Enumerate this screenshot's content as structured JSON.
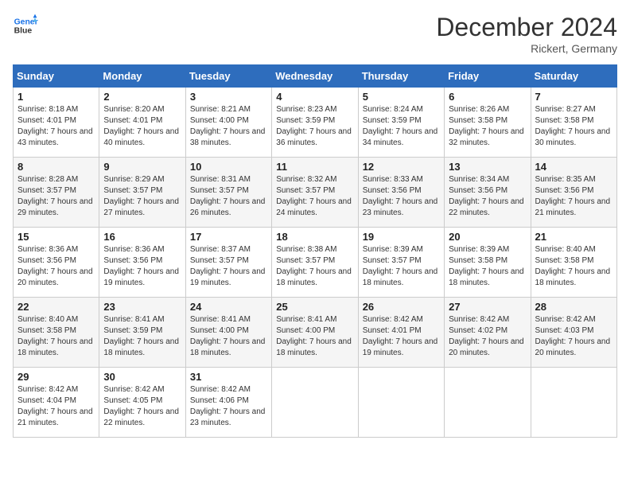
{
  "header": {
    "logo_line1": "General",
    "logo_line2": "Blue",
    "month": "December 2024",
    "location": "Rickert, Germany"
  },
  "weekdays": [
    "Sunday",
    "Monday",
    "Tuesday",
    "Wednesday",
    "Thursday",
    "Friday",
    "Saturday"
  ],
  "weeks": [
    [
      {
        "day": "1",
        "sunrise": "Sunrise: 8:18 AM",
        "sunset": "Sunset: 4:01 PM",
        "daylight": "Daylight: 7 hours and 43 minutes."
      },
      {
        "day": "2",
        "sunrise": "Sunrise: 8:20 AM",
        "sunset": "Sunset: 4:01 PM",
        "daylight": "Daylight: 7 hours and 40 minutes."
      },
      {
        "day": "3",
        "sunrise": "Sunrise: 8:21 AM",
        "sunset": "Sunset: 4:00 PM",
        "daylight": "Daylight: 7 hours and 38 minutes."
      },
      {
        "day": "4",
        "sunrise": "Sunrise: 8:23 AM",
        "sunset": "Sunset: 3:59 PM",
        "daylight": "Daylight: 7 hours and 36 minutes."
      },
      {
        "day": "5",
        "sunrise": "Sunrise: 8:24 AM",
        "sunset": "Sunset: 3:59 PM",
        "daylight": "Daylight: 7 hours and 34 minutes."
      },
      {
        "day": "6",
        "sunrise": "Sunrise: 8:26 AM",
        "sunset": "Sunset: 3:58 PM",
        "daylight": "Daylight: 7 hours and 32 minutes."
      },
      {
        "day": "7",
        "sunrise": "Sunrise: 8:27 AM",
        "sunset": "Sunset: 3:58 PM",
        "daylight": "Daylight: 7 hours and 30 minutes."
      }
    ],
    [
      {
        "day": "8",
        "sunrise": "Sunrise: 8:28 AM",
        "sunset": "Sunset: 3:57 PM",
        "daylight": "Daylight: 7 hours and 29 minutes."
      },
      {
        "day": "9",
        "sunrise": "Sunrise: 8:29 AM",
        "sunset": "Sunset: 3:57 PM",
        "daylight": "Daylight: 7 hours and 27 minutes."
      },
      {
        "day": "10",
        "sunrise": "Sunrise: 8:31 AM",
        "sunset": "Sunset: 3:57 PM",
        "daylight": "Daylight: 7 hours and 26 minutes."
      },
      {
        "day": "11",
        "sunrise": "Sunrise: 8:32 AM",
        "sunset": "Sunset: 3:57 PM",
        "daylight": "Daylight: 7 hours and 24 minutes."
      },
      {
        "day": "12",
        "sunrise": "Sunrise: 8:33 AM",
        "sunset": "Sunset: 3:56 PM",
        "daylight": "Daylight: 7 hours and 23 minutes."
      },
      {
        "day": "13",
        "sunrise": "Sunrise: 8:34 AM",
        "sunset": "Sunset: 3:56 PM",
        "daylight": "Daylight: 7 hours and 22 minutes."
      },
      {
        "day": "14",
        "sunrise": "Sunrise: 8:35 AM",
        "sunset": "Sunset: 3:56 PM",
        "daylight": "Daylight: 7 hours and 21 minutes."
      }
    ],
    [
      {
        "day": "15",
        "sunrise": "Sunrise: 8:36 AM",
        "sunset": "Sunset: 3:56 PM",
        "daylight": "Daylight: 7 hours and 20 minutes."
      },
      {
        "day": "16",
        "sunrise": "Sunrise: 8:36 AM",
        "sunset": "Sunset: 3:56 PM",
        "daylight": "Daylight: 7 hours and 19 minutes."
      },
      {
        "day": "17",
        "sunrise": "Sunrise: 8:37 AM",
        "sunset": "Sunset: 3:57 PM",
        "daylight": "Daylight: 7 hours and 19 minutes."
      },
      {
        "day": "18",
        "sunrise": "Sunrise: 8:38 AM",
        "sunset": "Sunset: 3:57 PM",
        "daylight": "Daylight: 7 hours and 18 minutes."
      },
      {
        "day": "19",
        "sunrise": "Sunrise: 8:39 AM",
        "sunset": "Sunset: 3:57 PM",
        "daylight": "Daylight: 7 hours and 18 minutes."
      },
      {
        "day": "20",
        "sunrise": "Sunrise: 8:39 AM",
        "sunset": "Sunset: 3:58 PM",
        "daylight": "Daylight: 7 hours and 18 minutes."
      },
      {
        "day": "21",
        "sunrise": "Sunrise: 8:40 AM",
        "sunset": "Sunset: 3:58 PM",
        "daylight": "Daylight: 7 hours and 18 minutes."
      }
    ],
    [
      {
        "day": "22",
        "sunrise": "Sunrise: 8:40 AM",
        "sunset": "Sunset: 3:58 PM",
        "daylight": "Daylight: 7 hours and 18 minutes."
      },
      {
        "day": "23",
        "sunrise": "Sunrise: 8:41 AM",
        "sunset": "Sunset: 3:59 PM",
        "daylight": "Daylight: 7 hours and 18 minutes."
      },
      {
        "day": "24",
        "sunrise": "Sunrise: 8:41 AM",
        "sunset": "Sunset: 4:00 PM",
        "daylight": "Daylight: 7 hours and 18 minutes."
      },
      {
        "day": "25",
        "sunrise": "Sunrise: 8:41 AM",
        "sunset": "Sunset: 4:00 PM",
        "daylight": "Daylight: 7 hours and 18 minutes."
      },
      {
        "day": "26",
        "sunrise": "Sunrise: 8:42 AM",
        "sunset": "Sunset: 4:01 PM",
        "daylight": "Daylight: 7 hours and 19 minutes."
      },
      {
        "day": "27",
        "sunrise": "Sunrise: 8:42 AM",
        "sunset": "Sunset: 4:02 PM",
        "daylight": "Daylight: 7 hours and 20 minutes."
      },
      {
        "day": "28",
        "sunrise": "Sunrise: 8:42 AM",
        "sunset": "Sunset: 4:03 PM",
        "daylight": "Daylight: 7 hours and 20 minutes."
      }
    ],
    [
      {
        "day": "29",
        "sunrise": "Sunrise: 8:42 AM",
        "sunset": "Sunset: 4:04 PM",
        "daylight": "Daylight: 7 hours and 21 minutes."
      },
      {
        "day": "30",
        "sunrise": "Sunrise: 8:42 AM",
        "sunset": "Sunset: 4:05 PM",
        "daylight": "Daylight: 7 hours and 22 minutes."
      },
      {
        "day": "31",
        "sunrise": "Sunrise: 8:42 AM",
        "sunset": "Sunset: 4:06 PM",
        "daylight": "Daylight: 7 hours and 23 minutes."
      },
      null,
      null,
      null,
      null
    ]
  ]
}
